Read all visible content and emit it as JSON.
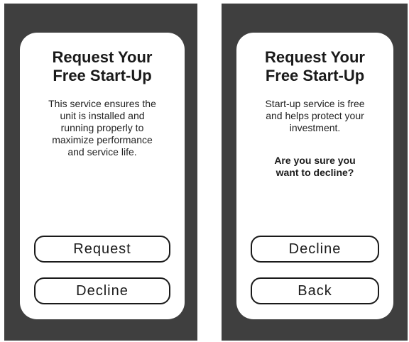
{
  "screens": [
    {
      "title": "Request Your\nFree Start-Up",
      "body": "This service ensures the\nunit is installed and\nrunning properly to\nmaximize performance\nand service life.",
      "buttons": [
        "Request",
        "Decline"
      ]
    },
    {
      "title": "Request Your\nFree Start-Up",
      "body": "Start-up service is free\nand helps protect your\ninvestment.",
      "question": "Are you sure you\nwant to decline?",
      "buttons": [
        "Decline",
        "Back"
      ]
    }
  ]
}
